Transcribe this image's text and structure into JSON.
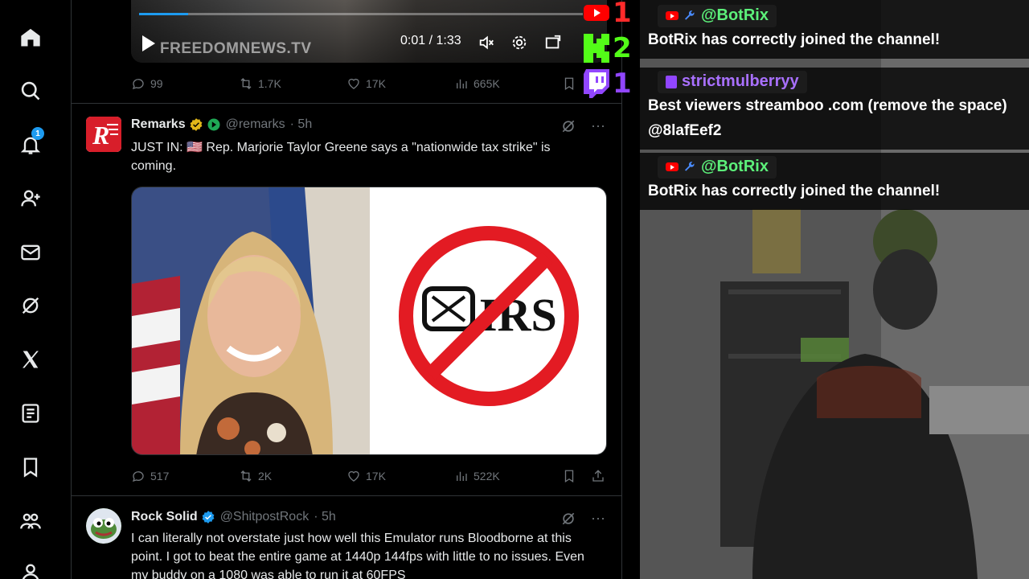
{
  "nav": {
    "items": [
      {
        "icon": "home-icon"
      },
      {
        "icon": "search-icon"
      },
      {
        "icon": "bell-icon",
        "badge": "1"
      },
      {
        "icon": "add-person-icon"
      },
      {
        "icon": "mail-icon"
      },
      {
        "icon": "grok-icon"
      },
      {
        "icon": "x-logo-icon"
      },
      {
        "icon": "list-icon"
      },
      {
        "icon": "bookmark-icon"
      },
      {
        "icon": "communities-icon"
      },
      {
        "icon": "profile-icon"
      }
    ]
  },
  "video": {
    "brand": "FREEDOMNEWS.TV",
    "time": "0:01 / 1:33",
    "progress": 0.011
  },
  "tweet0_actions": {
    "replies": "99",
    "reposts": "1.7K",
    "likes": "17K",
    "views": "665K"
  },
  "tweet1": {
    "name": "Remarks",
    "handle": "@remarks",
    "time": "· 5h",
    "text": "JUST IN: 🇺🇸 Rep. Marjorie Taylor Greene says a \"nationwide tax strike\" is coming.",
    "irs_label": "IRS",
    "actions": {
      "replies": "517",
      "reposts": "2K",
      "likes": "17K",
      "views": "522K"
    }
  },
  "tweet2": {
    "name": "Rock Solid",
    "handle": "@ShitpostRock",
    "time": "· 5h",
    "text": "I can literally not overstate just how well this Emulator runs Bloodborne at this point. I got to beat the entire game at 1440p 144fps with little to no issues. Even my buddy on a 1080 was able to run it at 60FPS"
  },
  "viewers": [
    {
      "platform": "youtube",
      "count": "1",
      "color": "#ff2a2a"
    },
    {
      "platform": "kick",
      "count": "2",
      "color": "#53fc18"
    },
    {
      "platform": "twitch",
      "count": "1",
      "color": "#9146ff"
    }
  ],
  "chat": [
    {
      "platform": "youtube",
      "user": "@BotRix",
      "user_color": "#5cf07a",
      "text": "BotRix has correctly joined the channel!"
    },
    {
      "platform": "twitch",
      "user": "strictmulberryy",
      "user_color": "#a970ff",
      "text": "Best viewers streamboo .com (remove the space) @8lafEef2"
    },
    {
      "platform": "youtube",
      "user": "@BotRix",
      "user_color": "#5cf07a",
      "text": "BotRix has correctly joined the channel!"
    }
  ]
}
